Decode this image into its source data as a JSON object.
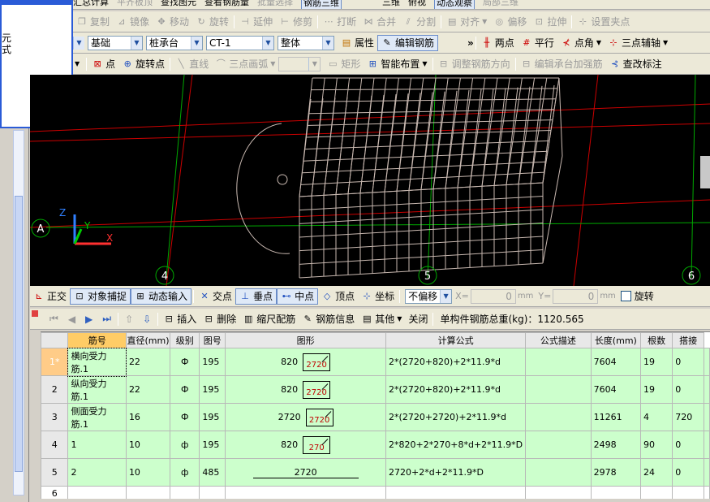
{
  "menubar": {
    "items": [
      "汇总计算",
      "平齐板顶",
      "查找图元",
      "查看钢筋量",
      "批量选择",
      "钢筋三维",
      "三维",
      "俯视",
      "动态观察",
      "局部三维"
    ]
  },
  "edit_toolbar": {
    "items": [
      "复制",
      "镜像",
      "移动",
      "旋转",
      "延伸",
      "修剪",
      "打断",
      "合并",
      "分割",
      "对齐",
      "偏移",
      "拉伸",
      "设置夹点"
    ]
  },
  "prop_toolbar": {
    "combo1": "",
    "combo2": "基础",
    "combo3": "桩承台",
    "combo4": "CT-1",
    "combo5": "整体",
    "property": "属性",
    "edit_rebar": "编辑钢筋",
    "right_items": [
      "两点",
      "平行",
      "点角",
      "三点辅轴"
    ]
  },
  "draw_toolbar": {
    "items": [
      "点",
      "旋转点",
      "直线",
      "三点画弧",
      "矩形",
      "智能布置",
      "调整钢筋方向",
      "编辑承台加强筋",
      "查改标注"
    ]
  },
  "popup": {
    "line1": "元",
    "line2": "式"
  },
  "viewport": {
    "axis_labels": [
      "A",
      "4",
      "5",
      "6"
    ],
    "axis_z": "Z",
    "axis_y": "Y",
    "axis_x": "X"
  },
  "snapbar": {
    "items": [
      "正交",
      "对象捕捉",
      "动态输入",
      "交点",
      "垂点",
      "中点",
      "顶点",
      "坐标"
    ],
    "offset_value": "不偏移",
    "x_label": "X=",
    "x_value": "0",
    "x_unit": "mm",
    "y_label": "Y=",
    "y_value": "0",
    "y_unit": "mm",
    "rotate_label": "旋转"
  },
  "tablebar": {
    "items": [
      "插入",
      "删除",
      "缩尺配筋",
      "钢筋信息",
      "其他",
      "关闭"
    ],
    "total_label": "单构件钢筋总重(kg)：1120.565"
  },
  "table": {
    "headers": [
      "筋号",
      "直径(mm)",
      "级别",
      "图号",
      "图形",
      "计算公式",
      "公式描述",
      "长度(mm)",
      "根数",
      "搭接"
    ],
    "rows": [
      {
        "no": "1*",
        "name": "横向受力筋.1",
        "dia": "22",
        "grade": "Ф",
        "fig": "195",
        "shape_left": "820",
        "shape_box": "2720",
        "formula": "2*(2720+820)+2*11.9*d",
        "desc": "",
        "length": "7604",
        "count": "19",
        "lap": "0"
      },
      {
        "no": "2",
        "name": "纵向受力筋.1",
        "dia": "22",
        "grade": "Ф",
        "fig": "195",
        "shape_left": "820",
        "shape_box": "2720",
        "formula": "2*(2720+820)+2*11.9*d",
        "desc": "",
        "length": "7604",
        "count": "19",
        "lap": "0"
      },
      {
        "no": "3",
        "name": "侧面受力筋.1",
        "dia": "16",
        "grade": "Ф",
        "fig": "195",
        "shape_left": "2720",
        "shape_box": "2720",
        "formula": "2*(2720+2720)+2*11.9*d",
        "desc": "",
        "length": "11261",
        "count": "4",
        "lap": "720"
      },
      {
        "no": "4",
        "name": "1",
        "dia": "10",
        "grade": "ф",
        "fig": "195",
        "shape_left": "820",
        "shape_box": "270",
        "formula": "2*820+2*270+8*d+2*11.9*D",
        "desc": "",
        "length": "2498",
        "count": "90",
        "lap": "0"
      },
      {
        "no": "5",
        "name": "2",
        "dia": "10",
        "grade": "ф",
        "fig": "485",
        "shape_left": "",
        "shape_box": "2720",
        "formula": "2720+2*d+2*11.9*D",
        "desc": "",
        "length": "2978",
        "count": "24",
        "lap": "0"
      },
      {
        "no": "6",
        "name": "",
        "dia": "",
        "grade": "",
        "fig": "",
        "shape_left": "",
        "shape_box": "",
        "formula": "",
        "desc": "",
        "length": "",
        "count": "",
        "lap": ""
      }
    ]
  },
  "colors": {
    "accent": "#2a5bd7",
    "row_green": "#ccffcc",
    "viewport_bg": "#000000",
    "grid_red": "#cc0000",
    "grid_green": "#00aa00",
    "mesh": "#c8b8b0"
  }
}
